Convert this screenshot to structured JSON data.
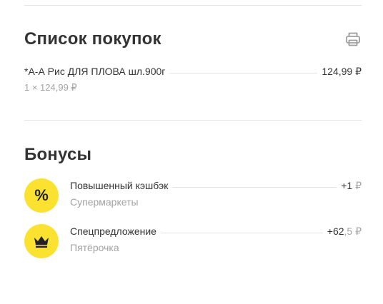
{
  "purchases": {
    "title": "Список покупок",
    "print_icon": "printer-icon",
    "items": [
      {
        "name": "*А-А Рис ДЛЯ ПЛОВА шл.900г",
        "price": "124,99 ₽",
        "quantity_line": "1 × 124,99 ₽"
      }
    ]
  },
  "bonuses": {
    "title": "Бонусы",
    "items": [
      {
        "icon": "percent-icon",
        "badge_text": "%",
        "title": "Повышенный кэшбэк",
        "subtitle": "Супермаркеты",
        "amount_main": "+1",
        "amount_suffix": " ₽"
      },
      {
        "icon": "crown-icon",
        "title": "Спецпредложение",
        "subtitle": "Пятёрочка",
        "amount_main": "+62",
        "amount_suffix": ",5 ₽"
      }
    ]
  },
  "colors": {
    "badge": "#fbe230",
    "text": "#333333",
    "muted": "#a3a3a3",
    "divider": "#e5e5e5"
  }
}
